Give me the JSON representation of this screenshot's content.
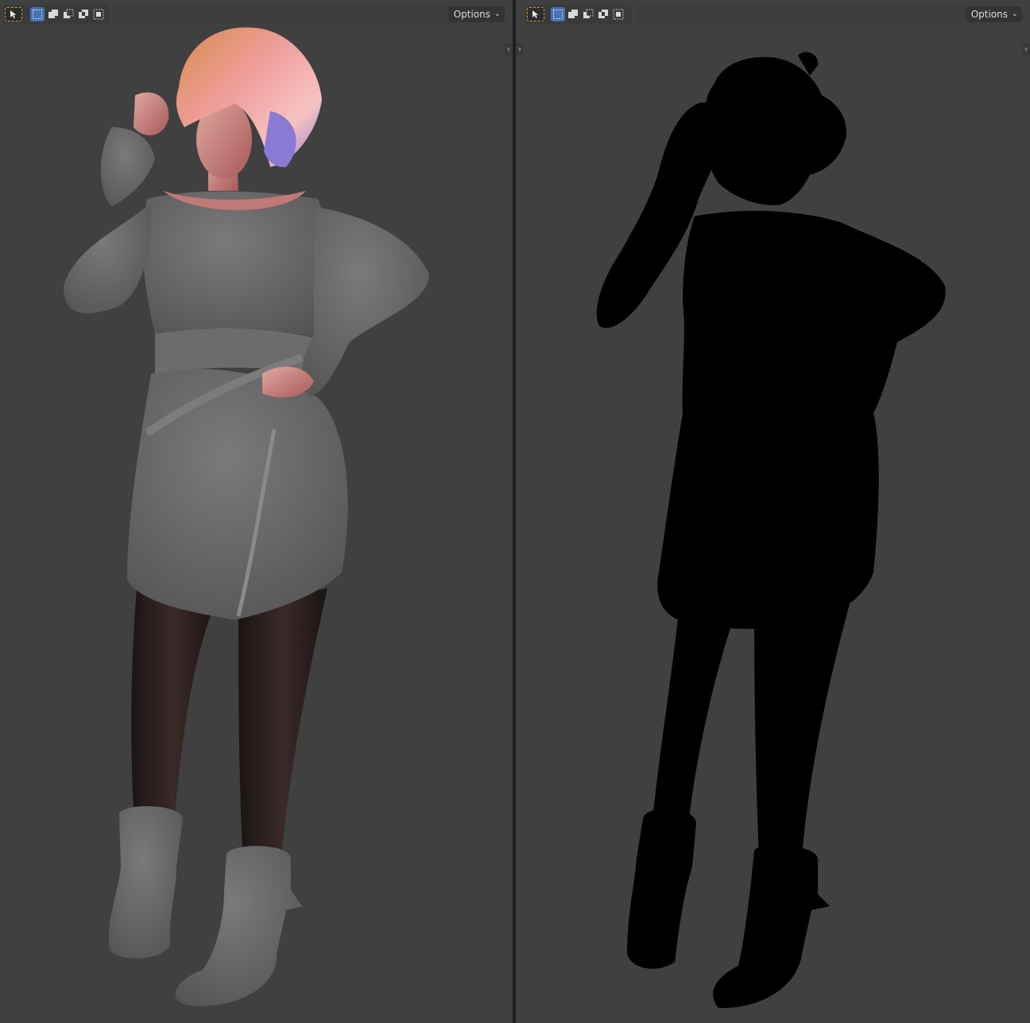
{
  "viewports": [
    {
      "id": "left",
      "header": {
        "options_label": "Options",
        "tools": [
          "select-box-icon",
          "mode-new-icon",
          "mode-extend-icon",
          "mode-subtract-icon",
          "mode-difference-icon",
          "mode-intersect-icon"
        ]
      },
      "content": "shaded-render"
    },
    {
      "id": "right",
      "header": {
        "options_label": "Options",
        "tools": [
          "select-box-icon",
          "mode-new-icon",
          "mode-extend-icon",
          "mode-subtract-icon",
          "mode-difference-icon",
          "mode-intersect-icon"
        ]
      },
      "content": "silhouette"
    }
  ],
  "colors": {
    "viewport_bg": "#404040",
    "header_accent": "#4772b3",
    "select_outline": "#d49a3d",
    "silhouette": "#000000",
    "clothing": "#6a6a6a",
    "tights": "#241a1a",
    "hair_gradient": [
      "#d98a4a",
      "#f0a0a0",
      "#f6c3c0",
      "#8a7ad6"
    ]
  }
}
